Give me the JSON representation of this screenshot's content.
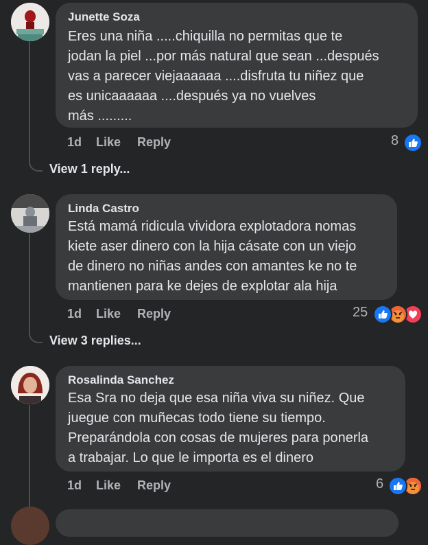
{
  "comments": [
    {
      "author": "Junette Soza",
      "lines": [
        "Eres una niña .....chiquilla no permitas que te",
        "jodan la piel ...por más natural que sean ...después",
        "vas a parecer viejaaaaaa ....disfruta tu niñez que",
        "es unicaaaaaa ....después ya no vuelves",
        "más ........."
      ],
      "time": "1d",
      "like_label": "Like",
      "reply_label": "Reply",
      "reaction_count": "8",
      "reactions": [
        "like"
      ],
      "view_replies": "View 1 reply..."
    },
    {
      "author": "Linda Castro",
      "lines": [
        "Está mamá ridicula vividora explotadora nomas",
        "kiete aser dinero con la hija  cásate con un viejo",
        "de dinero no niñas andes con amantes ke no te",
        "mantienen  para ke dejes de explotar ala hija"
      ],
      "time": "1d",
      "like_label": "Like",
      "reply_label": "Reply",
      "reaction_count": "25",
      "reactions": [
        "like",
        "angry",
        "love"
      ],
      "view_replies": "View 3 replies..."
    },
    {
      "author": "Rosalinda Sanchez",
      "lines": [
        "Esa Sra no deja que esa niña viva su niñez. Que",
        "juegue con muñecas todo tiene su tiempo.",
        "Preparándola con cosas de mujeres para ponerla",
        "a trabajar. Lo que le importa es el dinero"
      ],
      "time": "1d",
      "like_label": "Like",
      "reply_label": "Reply",
      "reaction_count": "6",
      "reactions": [
        "like",
        "angry"
      ]
    }
  ],
  "colors": {
    "background": "#242526",
    "bubble": "#3a3b3c",
    "like": "#1877f2",
    "angry": "#f0643a",
    "love": "#f33e58"
  }
}
